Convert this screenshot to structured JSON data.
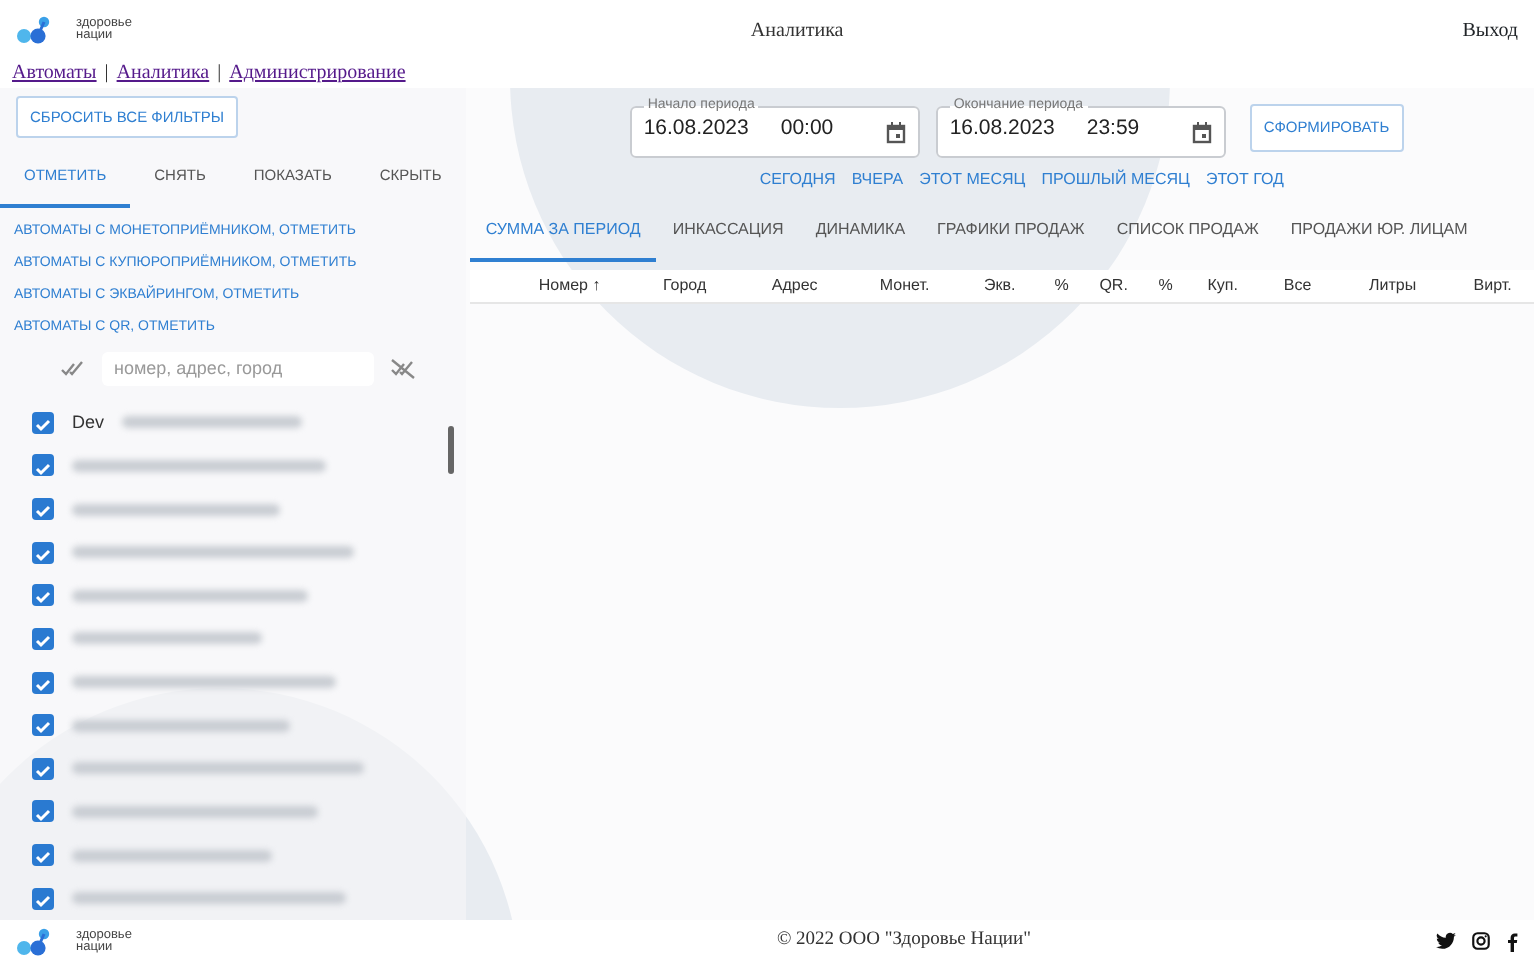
{
  "header": {
    "logo_text": [
      "здоровье",
      "нации"
    ],
    "title": "Аналитика",
    "logout": "Выход"
  },
  "nav_links": [
    {
      "label": "Автоматы"
    },
    {
      "label": "Аналитика"
    },
    {
      "label": "Администрирование"
    }
  ],
  "nav_separator": "|",
  "sidebar": {
    "reset_button": "СБРОСИТЬ ВСЕ ФИЛЬТРЫ",
    "tabs": [
      {
        "label": "ОТМЕТИТЬ",
        "selected": true
      },
      {
        "label": "СНЯТЬ",
        "selected": false
      },
      {
        "label": "ПОКАЗАТЬ",
        "selected": false
      },
      {
        "label": "СКРЫТЬ",
        "selected": false
      }
    ],
    "quick_links": [
      "АВТОМАТЫ С МОНЕТОПРИЁМНИКОМ, ОТМЕТИТЬ",
      "АВТОМАТЫ С КУПЮРОПРИЁМНИКОМ, ОТМЕТИТЬ",
      "АВТОМАТЫ С ЭКВАЙРИНГОМ, ОТМЕТИТЬ",
      "АВТОМАТЫ С QR, ОТМЕТИТЬ"
    ],
    "search": {
      "placeholder": "номер, адрес, город"
    },
    "machines": [
      {
        "label": "Dev",
        "checked": true
      },
      {
        "checked": true
      },
      {
        "checked": true
      },
      {
        "checked": true
      },
      {
        "checked": true
      },
      {
        "checked": true
      },
      {
        "checked": true
      },
      {
        "checked": true
      },
      {
        "checked": true
      },
      {
        "checked": true
      },
      {
        "checked": true
      },
      {
        "checked": true
      }
    ]
  },
  "period": {
    "start": {
      "label": "Начало периода",
      "date": "16.08.2023",
      "time": "00:00"
    },
    "end": {
      "label": "Окончание периода",
      "date": "16.08.2023",
      "time": "23:59"
    },
    "submit": "СФОРМИРОВАТЬ",
    "presets": [
      "СЕГОДНЯ",
      "ВЧЕРА",
      "ЭТОТ МЕСЯЦ",
      "ПРОШЛЫЙ МЕСЯЦ",
      "ЭТОТ ГОД"
    ]
  },
  "report_tabs": [
    {
      "label": "СУММА ЗА ПЕРИОД",
      "selected": true
    },
    {
      "label": "ИНКАССАЦИЯ",
      "selected": false
    },
    {
      "label": "ДИНАМИКА",
      "selected": false
    },
    {
      "label": "ГРАФИКИ ПРОДАЖ",
      "selected": false
    },
    {
      "label": "СПИСОК ПРОДАЖ",
      "selected": false
    },
    {
      "label": "ПРОДАЖИ ЮР. ЛИЦАМ",
      "selected": false
    }
  ],
  "table": {
    "columns": [
      {
        "label": "Номер",
        "sort": "↑"
      },
      {
        "label": "Город"
      },
      {
        "label": "Адрес"
      },
      {
        "label": "Монет."
      },
      {
        "label": "Экв."
      },
      {
        "label": "%"
      },
      {
        "label": "QR."
      },
      {
        "label": "%"
      },
      {
        "label": "Куп."
      },
      {
        "label": "Все"
      },
      {
        "label": "Литры"
      },
      {
        "label": "Вирт."
      }
    ]
  },
  "footer": {
    "logo_text": [
      "здоровье",
      "нации"
    ],
    "copyright": "© 2022 ООО \"Здоровье Нации\""
  }
}
